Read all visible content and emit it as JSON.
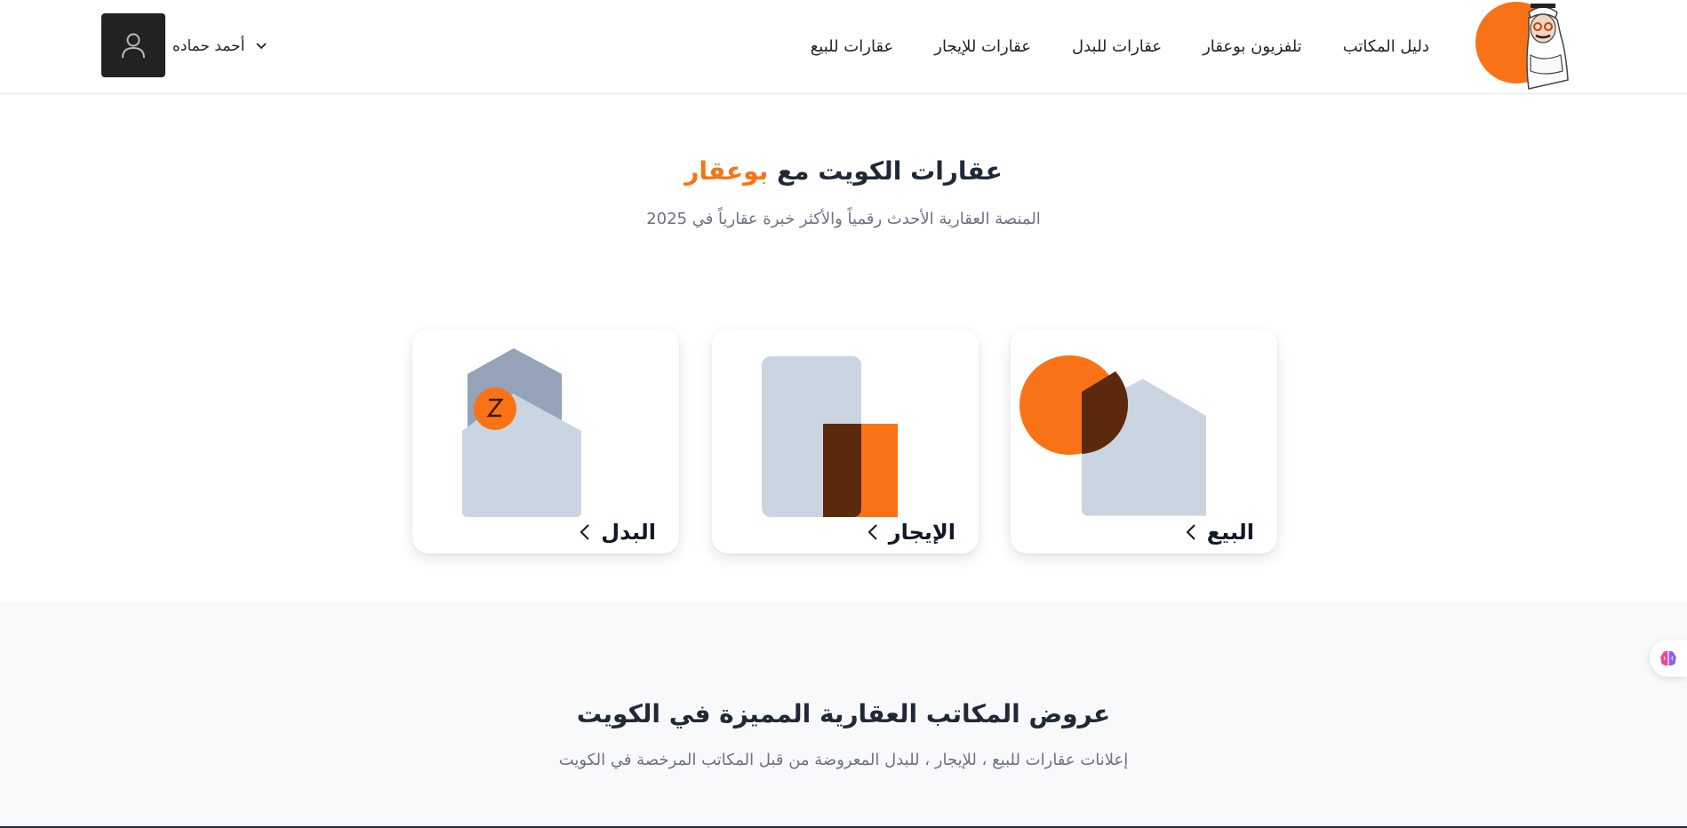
{
  "header": {
    "nav": [
      {
        "label": "عقارات للبيع"
      },
      {
        "label": "عقارات للإيجار"
      },
      {
        "label": "عقارات للبدل"
      },
      {
        "label": "تلفزيون بوعقار"
      },
      {
        "label": "دليل المكاتب"
      }
    ],
    "user_name": "أحمد حماده",
    "user_icon": "user-icon",
    "dropdown_icon": "chevron-down-icon"
  },
  "hero": {
    "title_main": "عقارات الكويت مع",
    "title_brand": "بوعقار",
    "subtitle": "المنصة العقارية الأحدث رقمياً والأكثر خبرة عقارياً في 2025"
  },
  "cards": [
    {
      "label": "البيع",
      "icon": "chevron-left-icon"
    },
    {
      "label": "الإيجار",
      "icon": "chevron-left-icon"
    },
    {
      "label": "البدل",
      "icon": "chevron-left-icon"
    }
  ],
  "offices": {
    "title": "عروض المكاتب العقارية المميزة في الكويت",
    "subtitle": "إعلانات عقارات للبيع ، للإيجار ، للبدل المعروضة من قبل المكاتب المرخصة في الكويت"
  },
  "colors": {
    "brand_orange": "#f97316",
    "dark_brown": "#5b2a0c",
    "house_gray": "#cbd5e1",
    "house_dark_gray": "#94a3b8"
  }
}
